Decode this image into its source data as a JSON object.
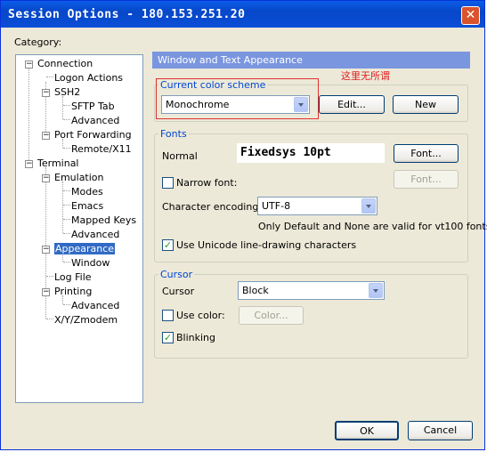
{
  "window": {
    "title": "Session Options - 180.153.251.20",
    "close_glyph": "✕"
  },
  "category_label": "Category:",
  "tree": {
    "connection": "Connection",
    "logon_actions": "Logon Actions",
    "ssh2": "SSH2",
    "sftp_tab": "SFTP Tab",
    "ssh2_advanced": "Advanced",
    "port_forwarding": "Port Forwarding",
    "remote_x11": "Remote/X11",
    "terminal": "Terminal",
    "emulation": "Emulation",
    "modes": "Modes",
    "emacs": "Emacs",
    "mapped_keys": "Mapped Keys",
    "emulation_advanced": "Advanced",
    "appearance": "Appearance",
    "window": "Window",
    "log_file": "Log File",
    "printing": "Printing",
    "printing_advanced": "Advanced",
    "xyzmodem": "X/Y/Zmodem",
    "expand_minus": "−"
  },
  "panel": {
    "header": "Window and Text Appearance",
    "annotation": "这里无所谓",
    "color_scheme": {
      "title": "Current color scheme",
      "selected": "Monochrome",
      "edit_button": "Edit...",
      "new_button": "New"
    },
    "fonts": {
      "title": "Fonts",
      "normal_label": "Normal",
      "normal_preview": "Fixedsys 10pt",
      "font_button": "Font...",
      "narrow_label": "Narrow font:",
      "narrow_checked": false,
      "narrow_font_button": "Font...",
      "encoding_label": "Character encoding:",
      "encoding_value": "UTF-8",
      "encoding_note": "Only Default and None are valid for vt100 fonts",
      "unicode_label": "Use Unicode line-drawing characters",
      "unicode_checked": true
    },
    "cursor": {
      "title": "Cursor",
      "cursor_label": "Cursor",
      "cursor_value": "Block",
      "use_color_label": "Use color:",
      "use_color_checked": false,
      "color_button": "Color...",
      "blinking_label": "Blinking",
      "blinking_checked": true
    }
  },
  "footer": {
    "ok_button": "OK",
    "cancel_button": "Cancel"
  },
  "check_glyph": "✓"
}
